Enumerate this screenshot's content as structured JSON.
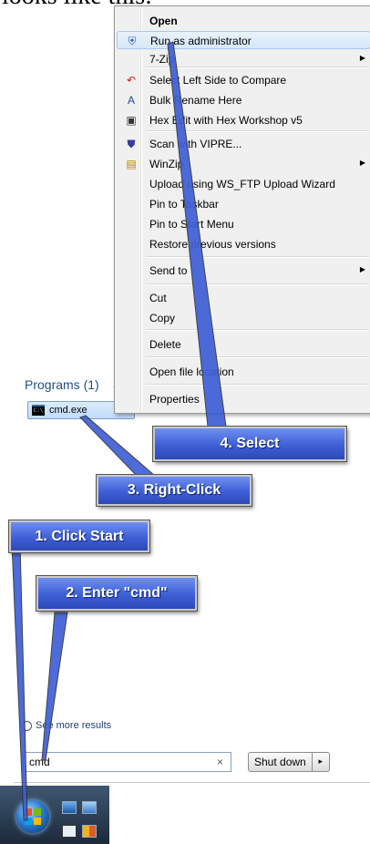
{
  "header_text": "looks like this:",
  "context_menu": {
    "items": [
      {
        "label": "Open",
        "icon": "none",
        "bold": true
      },
      {
        "label": "Run as administrator",
        "icon": "uac-shield-icon",
        "highlight": true
      },
      {
        "label": "7-Zip",
        "icon": "none",
        "submenu": true
      },
      {
        "label": "Select Left Side to Compare",
        "icon": "undo-arrow-icon"
      },
      {
        "label": "Bulk Rename Here",
        "icon": "bulk-rename-icon"
      },
      {
        "label": "Hex Edit with Hex Workshop v5",
        "icon": "hex-workshop-icon"
      },
      {
        "label": "Scan with VIPRE...",
        "icon": "vipre-shield-icon"
      },
      {
        "label": "WinZip",
        "icon": "winzip-icon",
        "submenu": true
      },
      {
        "label": "Upload using WS_FTP Upload Wizard",
        "icon": "none"
      },
      {
        "label": "Pin to Taskbar",
        "icon": "none"
      },
      {
        "label": "Pin to Start Menu",
        "icon": "none"
      },
      {
        "label": "Restore previous versions",
        "icon": "none"
      },
      {
        "label": "Send to",
        "icon": "none",
        "submenu": true
      },
      {
        "label": "Cut",
        "icon": "none"
      },
      {
        "label": "Copy",
        "icon": "none"
      },
      {
        "label": "Delete",
        "icon": "none"
      },
      {
        "label": "Open file location",
        "icon": "none"
      },
      {
        "label": "Properties",
        "icon": "none"
      }
    ]
  },
  "start_menu": {
    "programs_header": "Programs (1)",
    "result_label": "cmd.exe",
    "cmd_icon_text": "C:\\",
    "see_more": "See more results",
    "search_value": "cmd",
    "search_clear": "×",
    "shutdown_label": "Shut down",
    "shutdown_arrow": "▸"
  },
  "callouts": {
    "step1": "1. Click Start",
    "step2": "2. Enter \"cmd\"",
    "step3": "3. Right-Click",
    "step4": "4. Select"
  },
  "colors": {
    "callout_blue": "#3e5fd6",
    "menu_bg": "#f0f0f0",
    "taskbar": "#1c2a3a"
  }
}
